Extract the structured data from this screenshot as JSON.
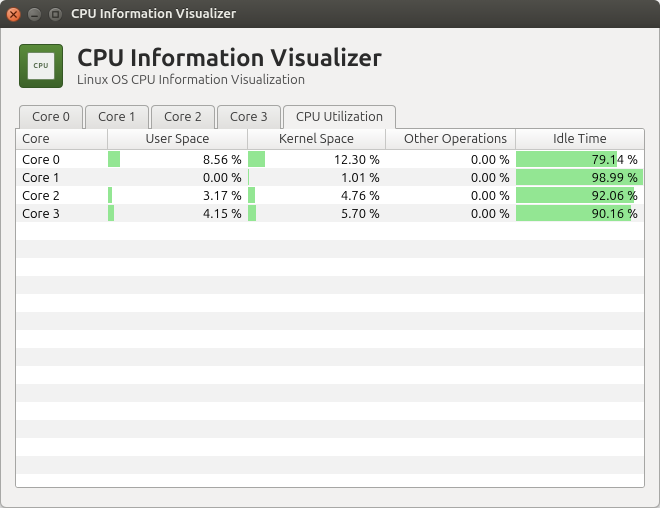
{
  "window": {
    "title": "CPU Information Visualizer"
  },
  "header": {
    "title": "CPU Information Visualizer",
    "subtitle": "Linux OS CPU Information Visualization",
    "icon_chip_label": "CPU"
  },
  "tabs": [
    {
      "label": "Core 0",
      "active": false
    },
    {
      "label": "Core 1",
      "active": false
    },
    {
      "label": "Core 2",
      "active": false
    },
    {
      "label": "Core 3",
      "active": false
    },
    {
      "label": "CPU Utilization",
      "active": true
    }
  ],
  "columns": {
    "core": "Core",
    "user": "User Space",
    "kernel": "Kernel Space",
    "other": "Other Operations",
    "idle": "Idle Time"
  },
  "rows": [
    {
      "core": "Core 0",
      "user": 8.56,
      "kernel": 12.3,
      "other": 0.0,
      "idle": 79.14
    },
    {
      "core": "Core 1",
      "user": 0.0,
      "kernel": 1.01,
      "other": 0.0,
      "idle": 98.99
    },
    {
      "core": "Core 2",
      "user": 3.17,
      "kernel": 4.76,
      "other": 0.0,
      "idle": 92.06
    },
    {
      "core": "Core 3",
      "user": 4.15,
      "kernel": 5.7,
      "other": 0.0,
      "idle": 90.16
    }
  ],
  "chart_data": {
    "type": "table",
    "title": "CPU Utilization",
    "columns": [
      "Core",
      "User Space",
      "Kernel Space",
      "Other Operations",
      "Idle Time"
    ],
    "units": "%",
    "data": [
      [
        "Core 0",
        8.56,
        12.3,
        0.0,
        79.14
      ],
      [
        "Core 1",
        0.0,
        1.01,
        0.0,
        98.99
      ],
      [
        "Core 2",
        3.17,
        4.76,
        0.0,
        92.06
      ],
      [
        "Core 3",
        4.15,
        5.7,
        0.0,
        90.16
      ]
    ]
  },
  "empty_row_count": 15
}
